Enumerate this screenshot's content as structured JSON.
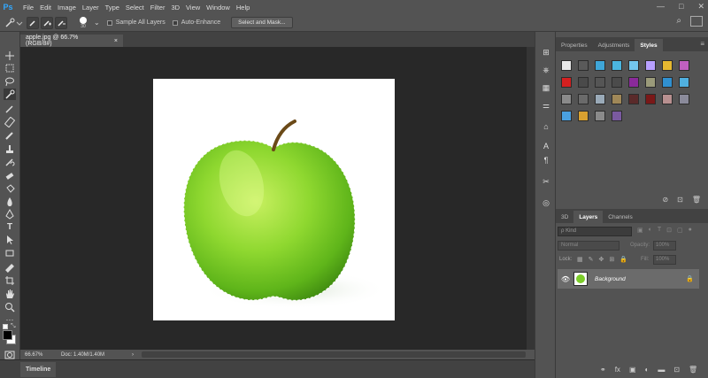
{
  "app": {
    "logo": "Ps"
  },
  "menu": [
    "File",
    "Edit",
    "Image",
    "Layer",
    "Type",
    "Select",
    "Filter",
    "3D",
    "View",
    "Window",
    "Help"
  ],
  "window_controls": {
    "minimize": "—",
    "maximize": "□",
    "close": "✕"
  },
  "options": {
    "brush_size": "30",
    "sample_all_layers": "Sample All Layers",
    "auto_enhance": "Auto-Enhance",
    "select_and_mask": "Select and Mask..."
  },
  "document": {
    "tab_title": "apple.jpg @ 66.7% (RGB/8#)",
    "close": "×"
  },
  "status": {
    "zoom": "66.67%",
    "doc": "Doc: 1.40M/1.40M",
    "arrow": "›"
  },
  "timeline": {
    "tab": "Timeline"
  },
  "panel_top": {
    "tabs": [
      "Properties",
      "Adjustments",
      "Styles"
    ],
    "active": "Styles"
  },
  "panel_bottom": {
    "tabs": [
      "3D",
      "Layers",
      "Channels"
    ],
    "active": "Layers"
  },
  "layers": {
    "filter_kind": "ρ Kind",
    "blend_mode": "Normal",
    "opacity_label": "Opacity:",
    "opacity_value": "100%",
    "lock_label": "Lock:",
    "fill_label": "Fill:",
    "fill_value": "100%",
    "items": [
      {
        "name": "Background",
        "visible": true,
        "locked": true
      }
    ]
  },
  "styles_swatches": [
    [
      "#e8e8e8",
      "#5a5a5a",
      "#3fa6d8",
      "#4bb6e0",
      "#73c7ee",
      "#b8a0ff",
      "#e6b830",
      "#c060c0"
    ],
    [
      "#d42020",
      "#4a4a4a",
      "#555555",
      "#4b4b4b",
      "#8a2a9a",
      "#9a9a7a",
      "#3090d0",
      "#50b0e0"
    ],
    [
      "#8a8a8a",
      "#6a6a6a",
      "#9aaab8",
      "#a08858",
      "#5a2a2a",
      "#7a1818",
      "#b89090",
      "#8a8a9a"
    ],
    [
      "#4aa0e0",
      "#d8a030",
      "#8a8a8a",
      "#7a5aa0"
    ]
  ]
}
